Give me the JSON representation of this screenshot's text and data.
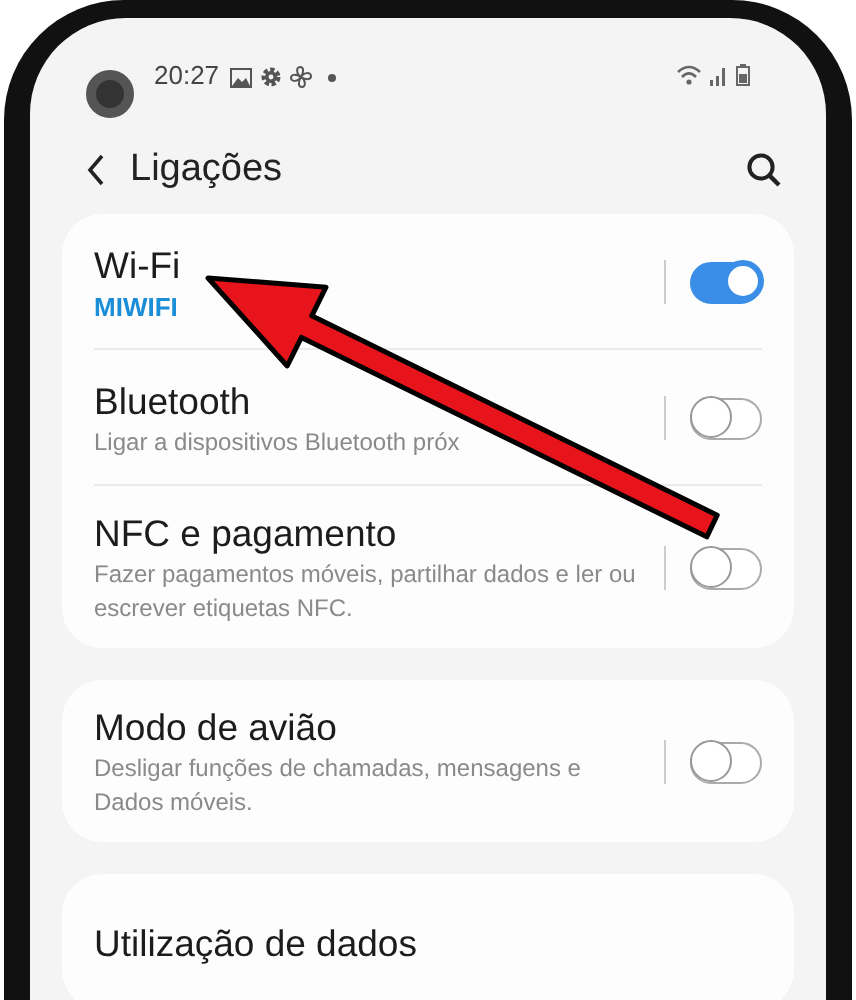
{
  "status_bar": {
    "time": "20:27"
  },
  "header": {
    "title": "Ligações"
  },
  "groups": [
    {
      "items": [
        {
          "kind": "toggle",
          "title": "Wi-Fi",
          "subtitle": "MIWIFI",
          "accent": true,
          "on": true
        },
        {
          "kind": "toggle",
          "title": "Bluetooth",
          "subtitle": "Ligar a dispositivos Bluetooth próx",
          "accent": false,
          "on": false
        },
        {
          "kind": "toggle",
          "title": "NFC e pagamento",
          "subtitle": "Fazer pagamentos móveis, partilhar dados e ler ou escrever etiquetas NFC.",
          "accent": false,
          "on": false
        }
      ]
    },
    {
      "items": [
        {
          "kind": "toggle",
          "title": "Modo de avião",
          "subtitle": "Desligar funções de chamadas, mensagens e Dados móveis.",
          "accent": false,
          "on": false
        }
      ]
    },
    {
      "items": [
        {
          "kind": "link",
          "title": "Utilização de dados"
        }
      ]
    }
  ]
}
